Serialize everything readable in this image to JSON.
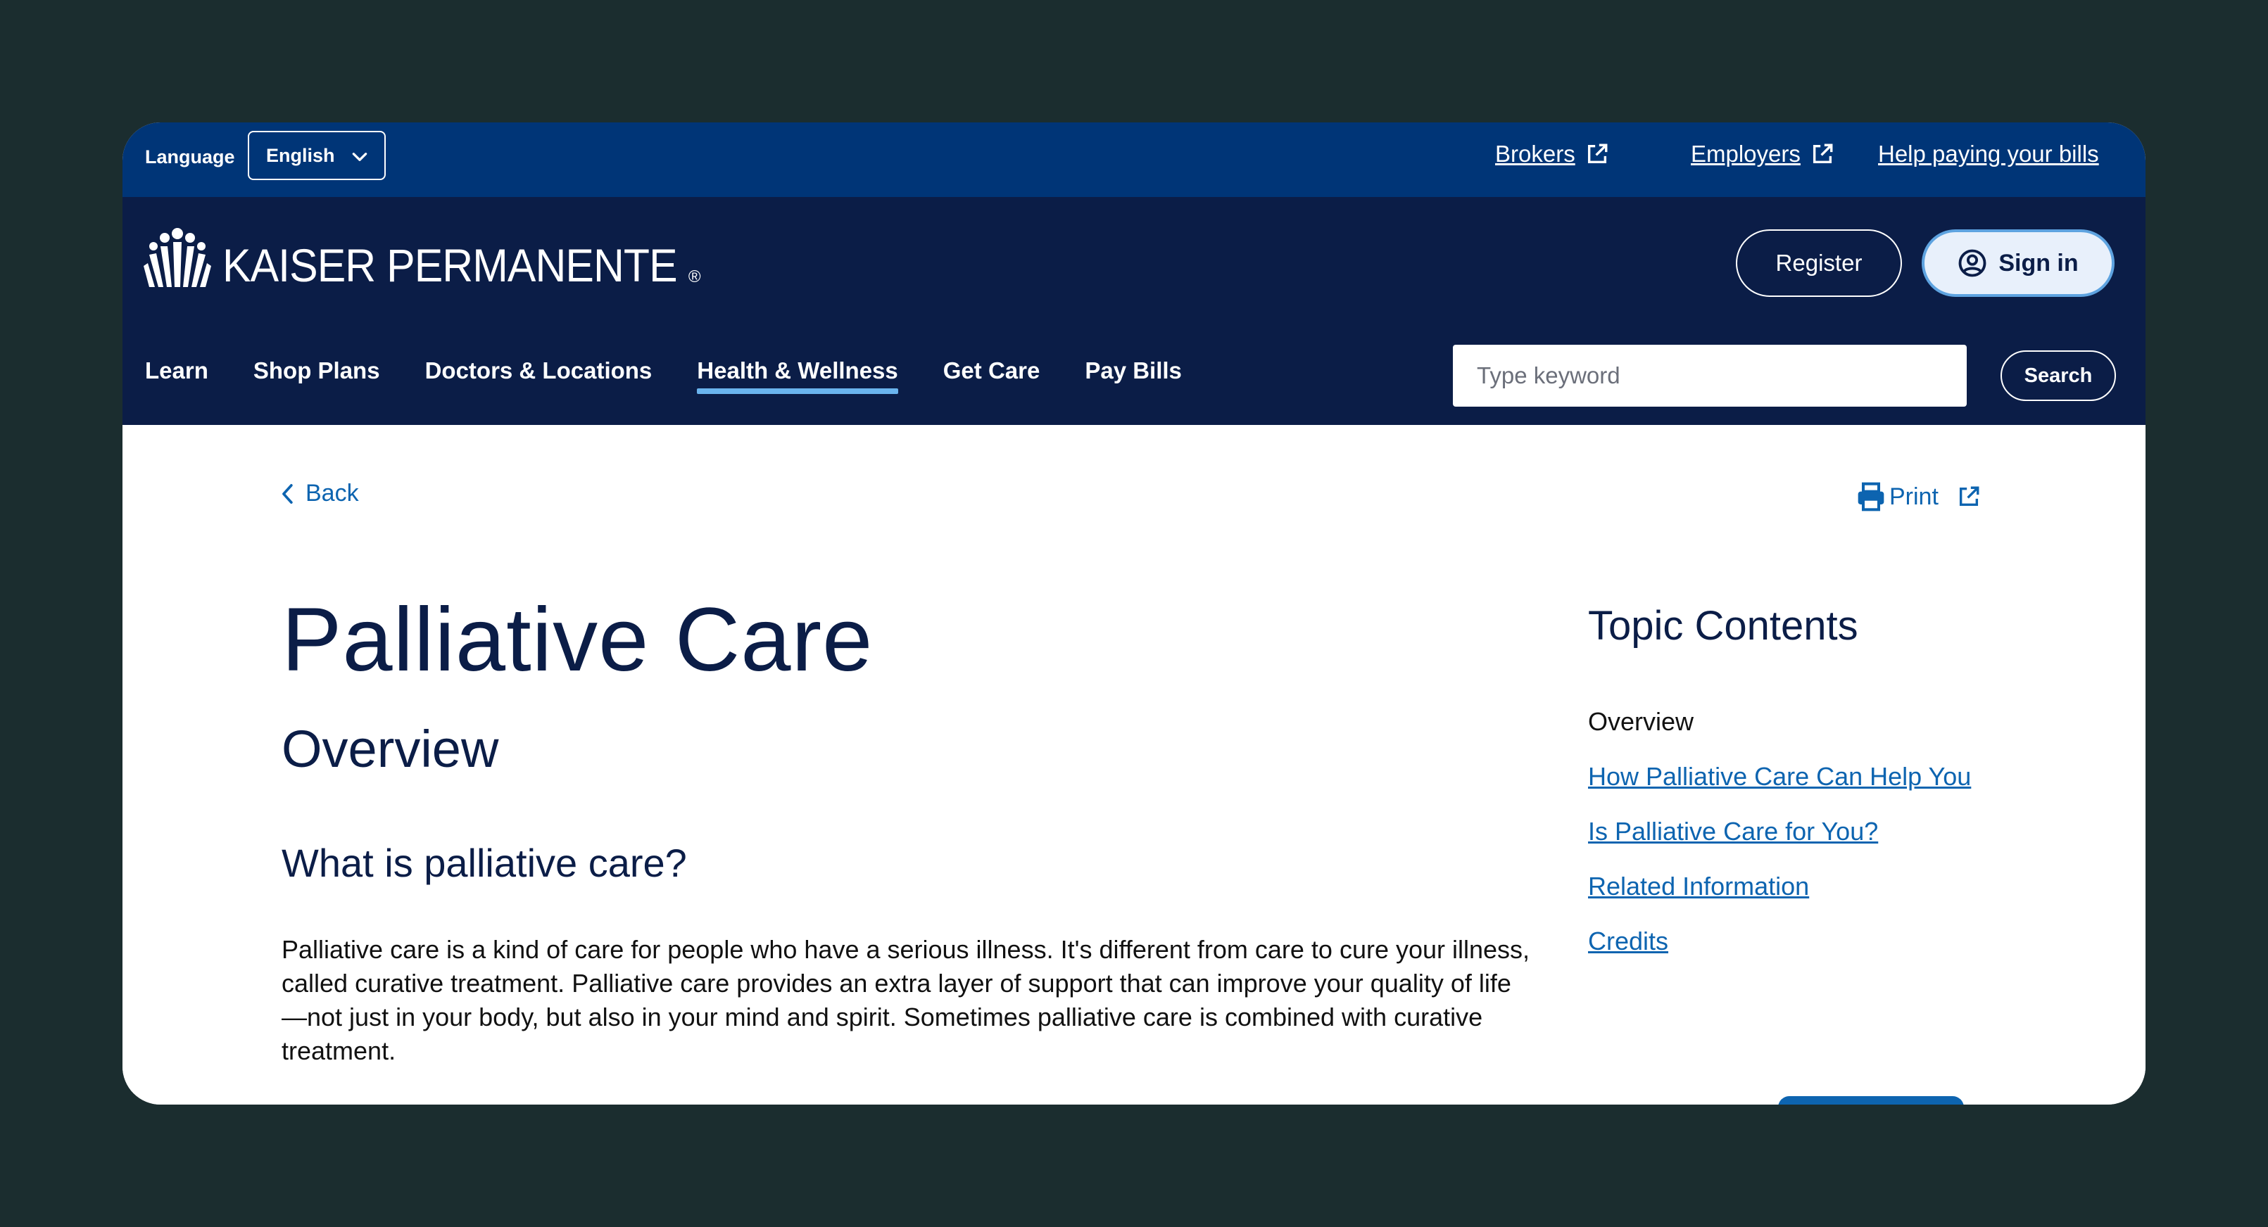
{
  "utility_bar": {
    "language_label": "Language",
    "language_selected": "English",
    "links": [
      {
        "label": "Brokers",
        "external": true
      },
      {
        "label": "Employers",
        "external": true
      },
      {
        "label": "Help paying your bills",
        "external": false
      }
    ]
  },
  "header": {
    "logo_text": "KAISER PERMANENTE",
    "logo_reg": "®",
    "register_label": "Register",
    "signin_label": "Sign in",
    "nav": [
      {
        "label": "Learn",
        "active": false
      },
      {
        "label": "Shop Plans",
        "active": false
      },
      {
        "label": "Doctors & Locations",
        "active": false
      },
      {
        "label": "Health & Wellness",
        "active": true
      },
      {
        "label": "Get Care",
        "active": false
      },
      {
        "label": "Pay Bills",
        "active": false
      }
    ],
    "search_placeholder": "Type keyword",
    "search_button": "Search"
  },
  "main": {
    "back_label": "Back",
    "print_label": "Print",
    "title": "Palliative Care",
    "section_title": "Overview",
    "subheading": "What is palliative care?",
    "body": "Palliative care is a kind of care for people who have a serious illness. It's different from care to cure your illness, called curative treatment. Palliative care provides an extra layer of support that can improve your quality of life—not just in your body, but also in your mind and spirit. Sometimes palliative care is combined with curative treatment."
  },
  "toc": {
    "title": "Topic Contents",
    "items": [
      {
        "label": "Overview",
        "current": true
      },
      {
        "label": "How Palliative Care Can Help You",
        "current": false
      },
      {
        "label": "Is Palliative Care for You?",
        "current": false
      },
      {
        "label": "Related Information",
        "current": false
      },
      {
        "label": "Credits",
        "current": false
      }
    ]
  },
  "colors": {
    "utility_bar": "#003577",
    "header": "#0b1d47",
    "link": "#0d64b0",
    "active_underline": "#6ab4ee",
    "backdrop": "#1b2d2f"
  }
}
